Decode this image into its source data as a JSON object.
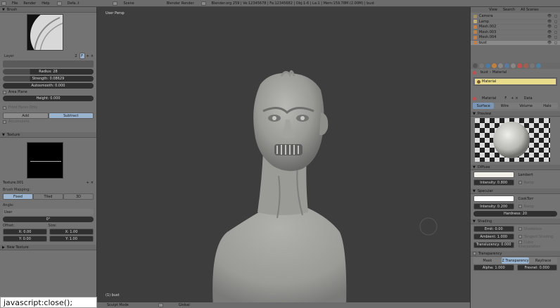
{
  "topbar": {
    "menus": [
      "File",
      "Render",
      "Help"
    ],
    "mode": "Defa..t",
    "scene": "Scene",
    "engine": "Blender Render",
    "info": "Blender.org 259 | Ve:12345678 | Fa:12345682 | Obj:1-6 | La:1 | Mem:159.78M (2.00M) | bust"
  },
  "left": {
    "brush_title": "Brush",
    "layer_label": "Layer",
    "layer_num": "2",
    "layer_f": "F",
    "radius": "Radius: 28",
    "strength": "Strength: 0.08629",
    "autosmooth": "Autosmooth: 0.000",
    "area_plane": "Area Plane",
    "height": "Height: 0.000",
    "front_faces": "Front Faces Only",
    "add": "Add",
    "subtract": "Subtract",
    "accumulate": "Accumulate",
    "texture_title": "Texture",
    "texture_name": "Texture.001",
    "brush_mapping": "Brush Mapping:",
    "fixed": "Fixed",
    "tiled": "Tiled",
    "threed": "3D",
    "angle": "Angle:",
    "user": "User",
    "angle_val": "0°",
    "offset": "Offset:",
    "size": "Size:",
    "off_x": "X: 0.00",
    "off_y": "Y: 0.00",
    "size_x": "X: 1.00",
    "size_y": "Y: 1.00",
    "new_texture": "New Texture"
  },
  "viewport": {
    "label": "User Persp",
    "object_label": "(1) bust",
    "mode": "Sculpt Mode",
    "shading": "Global"
  },
  "right": {
    "view_menu": "View",
    "search_menu": "Search",
    "all_scenes": "All Scenes",
    "outliner": [
      {
        "name": "Camera",
        "color": "#a09060"
      },
      {
        "name": "Lamp",
        "color": "#c0b070"
      },
      {
        "name": "Mesh.002",
        "color": "#c08040"
      },
      {
        "name": "Mesh.003",
        "color": "#c08040"
      },
      {
        "name": "Mesh.004",
        "color": "#c08040"
      },
      {
        "name": "bust",
        "color": "#c08040"
      }
    ],
    "breadcrumb_obj": "bust",
    "breadcrumb_mat": "Material",
    "material_slot": "Material",
    "material_name": "Material",
    "material_f": "F",
    "data": "Data",
    "tabs": [
      "Surface",
      "Wire",
      "Volume",
      "Halo"
    ],
    "preview_title": "Preview",
    "diffuse_title": "Diffuse",
    "lambert": "Lambert",
    "intensity_d": "Intensity: 0.800",
    "ramp": "Ramp",
    "specular_title": "Specular",
    "cooktorr": "CookTorr",
    "intensity_s": "Intensity: 0.200",
    "hardness": "Hardness: 20",
    "shading_title": "Shading",
    "emit": "Emit: 0.00",
    "ambient": "Ambient: 1.000",
    "translucency": "Translucency: 0.000",
    "shadeless": "Shadeless",
    "tangent": "Tangent Shading",
    "cubic": "Cubic Interpolation",
    "transparency_title": "Transparency",
    "mask": "Mask",
    "ztransp": "Z Transparency",
    "raytrace": "Raytrace",
    "alpha": "Alpha: 1.000",
    "fresnel": "Fresnel: 0.000"
  },
  "status": {
    "text": "javascript:close();"
  }
}
